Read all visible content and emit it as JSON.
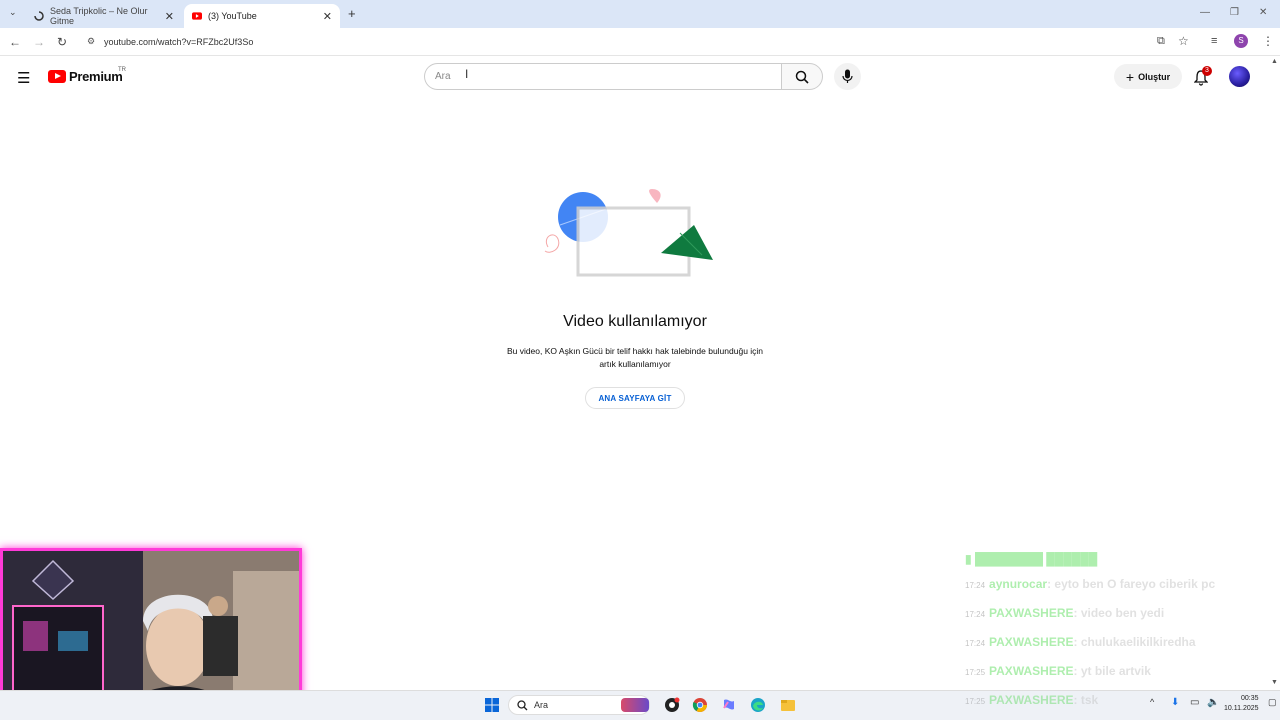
{
  "browser": {
    "tabs": [
      {
        "title": "Seda Tripkolic – Ne Olur Gitme"
      },
      {
        "title": "(3) YouTube"
      }
    ],
    "url": "youtube.com/watch?v=RFZbc2Uf3So"
  },
  "header": {
    "logo_text": "Premium",
    "region": "TR",
    "search_placeholder": "Ara",
    "create_label": "Oluştur",
    "notification_count": "3"
  },
  "main": {
    "title": "Video kullanılamıyor",
    "description": "Bu video, KO Aşkın Gücü bir telif hakkı hak talebinde bulunduğu için artık kullanılamıyor",
    "home_button": "ANA SAYFAYA GİT"
  },
  "chat": [
    {
      "time": "17:24",
      "name": "aynurocar",
      "msg": "eyto ben O fareyo ciberik pc"
    },
    {
      "time": "17:24",
      "name": "PAXWASHERE",
      "msg": "video ben yedi"
    },
    {
      "time": "17:24",
      "name": "PAXWASHERE",
      "msg": "chulukaelikilkiredha"
    },
    {
      "time": "17:25",
      "name": "PAXWASHERE",
      "msg": "yt bile artvik"
    },
    {
      "time": "17:25",
      "name": "PAXWASHERE",
      "msg": "tsk"
    }
  ],
  "taskbar": {
    "search_label": "Ara",
    "time": "00:35",
    "date": "10.11.2025"
  },
  "colors": {
    "yt_red": "#ff0000",
    "link_blue": "#065fd4",
    "cam_border": "#ff3ad8",
    "chat_name": "#19d019"
  }
}
